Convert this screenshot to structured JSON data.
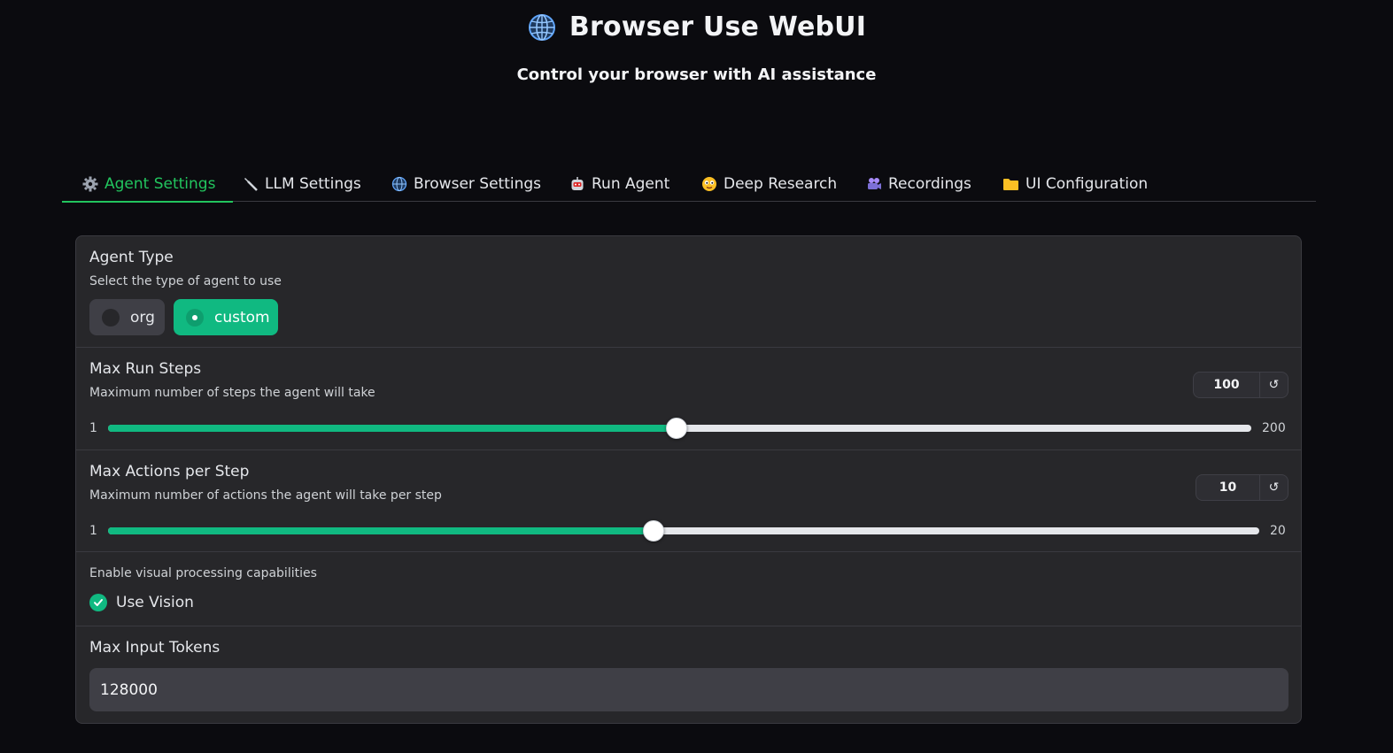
{
  "app": {
    "title": "Browser Use WebUI",
    "subtitle": "Control your browser with AI assistance",
    "title_icon": "globe-icon"
  },
  "tabs": [
    {
      "label": "Agent Settings",
      "icon": "gear-icon",
      "active": true
    },
    {
      "label": "LLM Settings",
      "icon": "wrench-icon",
      "active": false
    },
    {
      "label": "Browser Settings",
      "icon": "globe-icon",
      "active": false
    },
    {
      "label": "Run Agent",
      "icon": "robot-icon",
      "active": false
    },
    {
      "label": "Deep Research",
      "icon": "face-icon",
      "active": false
    },
    {
      "label": "Recordings",
      "icon": "camera-icon",
      "active": false
    },
    {
      "label": "UI Configuration",
      "icon": "folder-icon",
      "active": false
    }
  ],
  "agent_type": {
    "label": "Agent Type",
    "info": "Select the type of agent to use",
    "options": [
      "org",
      "custom"
    ],
    "selected": "custom"
  },
  "max_run_steps": {
    "label": "Max Run Steps",
    "info": "Maximum number of steps the agent will take",
    "value": "100",
    "min": "1",
    "max": "200",
    "fraction": 0.4975
  },
  "max_actions": {
    "label": "Max Actions per Step",
    "info": "Maximum number of actions the agent will take per step",
    "value": "10",
    "min": "1",
    "max": "20",
    "fraction": 0.4737
  },
  "use_vision": {
    "info": "Enable visual processing capabilities",
    "label": "Use Vision",
    "checked": true
  },
  "max_input_tokens": {
    "label": "Max Input Tokens",
    "value": "128000"
  },
  "reset_glyph": "↺",
  "colors": {
    "accent": "#10b981",
    "active_tab": "#22c55e",
    "background": "#0b0b0f",
    "panel": "#27272a"
  }
}
